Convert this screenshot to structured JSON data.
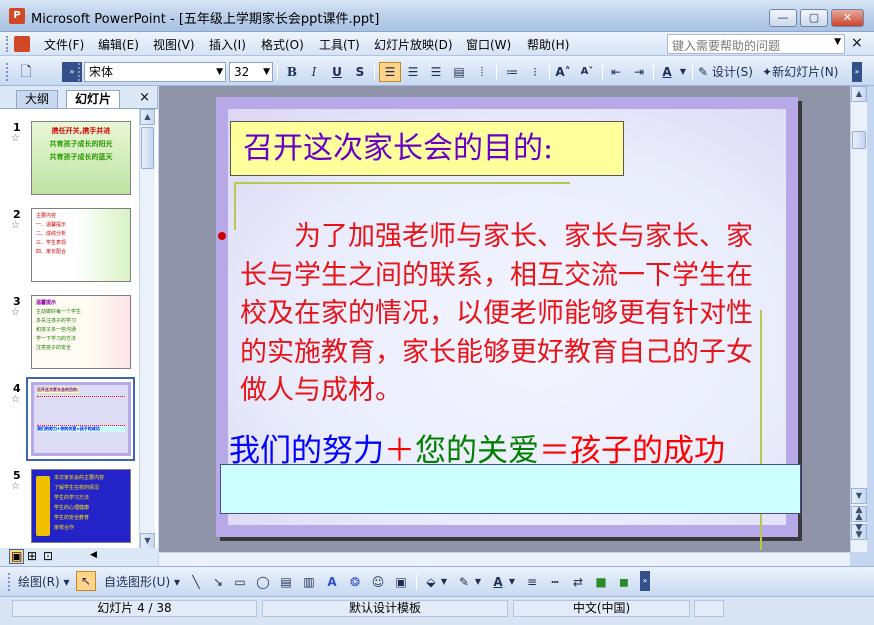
{
  "window": {
    "title": "Microsoft PowerPoint - [五年级上学期家长会ppt课件.ppt]",
    "app_icon": "P",
    "minimize_label": "—",
    "restore_label": "▢",
    "close_label": "✕"
  },
  "menu": {
    "items": [
      "文件(F)",
      "编辑(E)",
      "视图(V)",
      "插入(I)",
      "格式(O)",
      "工具(T)",
      "幻灯片放映(D)",
      "窗口(W)",
      "帮助(H)"
    ],
    "help_placeholder": "键入需要帮助的问题",
    "close_doc": "×"
  },
  "toolbar": {
    "font_name": "宋体",
    "font_size": "32",
    "bold": "B",
    "italic": "I",
    "underline": "U",
    "shadow": "S",
    "design_label": "设计(S)",
    "new_slide_label": "新幻灯片(N)"
  },
  "left_panel": {
    "tabs": [
      "大纲",
      "幻灯片"
    ],
    "close": "×",
    "slides": [
      {
        "num": "1",
        "lines": [
          "携任开关,携手并进",
          "共育孩子成长的阳光",
          "共育孩子成长的蓝天"
        ]
      },
      {
        "num": "2",
        "lines": [
          "主要内容",
          "一、温馨提示",
          "二、成绩分析",
          "三、学生表现",
          "四、家长配合"
        ]
      },
      {
        "num": "3",
        "lines": [
          "温馨提示",
          "主动做好每一个学生",
          "多关注孩子的学习",
          "和孩子多一些沟通",
          "学一下学习的方法",
          "注意孩子的安全"
        ]
      },
      {
        "num": "4",
        "lines": [
          "召开这次家长会的目的:",
          "我们的努力+你的关爱=孩子的成功"
        ]
      },
      {
        "num": "5",
        "lines": [
          "本次家长会的主要内容",
          "了解学生在校的情况",
          "学生的学习方法",
          "学生的心理健康",
          "学生的安全教育",
          "家校合作"
        ]
      }
    ],
    "selected_slide": "4"
  },
  "slide": {
    "title": "召开这次家长会的目的:",
    "body": "为了加强老师与家长、家长与家长、家长与学生之间的联系，相互交流一下学生在校及在家的情况，以便老师能够更有针对性的实施教育，家长能够更好教育自己的子女做人与成材。",
    "formula": [
      {
        "text": "我们的努力",
        "color": "#0000ff"
      },
      {
        "text": "＋",
        "color": "#ff0000"
      },
      {
        "text": "您的关爱",
        "color": "#008000"
      },
      {
        "text": "＝孩子的成功",
        "color": "#ff0000"
      }
    ]
  },
  "drawbar": {
    "draw_label": "绘图(R)",
    "autoshape_label": "自选图形(U)"
  },
  "status": {
    "slide_info": "幻灯片 4 / 38",
    "template": "默认设计模板",
    "language": "中文(中国)"
  }
}
